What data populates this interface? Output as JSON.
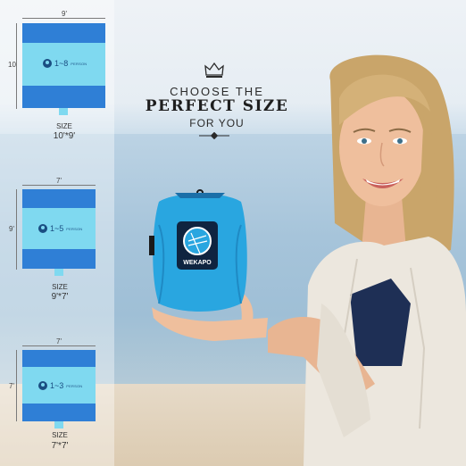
{
  "headline": {
    "line1": "CHOOSE THE",
    "line2": "PERFECT SIZE",
    "line3": "FOR YOU"
  },
  "sizes": [
    {
      "width_label": "9'",
      "height_label": "10'",
      "capacity": "1~8",
      "capacity_unit": "PERSON",
      "size_caption": "SIZE",
      "size_value": "10'*9'"
    },
    {
      "width_label": "7'",
      "height_label": "9'",
      "capacity": "1~5",
      "capacity_unit": "PERSON",
      "size_caption": "SIZE",
      "size_value": "9'*7'"
    },
    {
      "width_label": "7'",
      "height_label": "7'",
      "capacity": "1~3",
      "capacity_unit": "PERSON",
      "size_caption": "SIZE",
      "size_value": "7'*7'"
    }
  ],
  "product": {
    "brand": "WEKAPO"
  },
  "colors": {
    "mat_dark": "#2f7fd6",
    "mat_light": "#7fd9f0",
    "bag": "#29a6e0"
  },
  "icons": [
    "crown-icon",
    "person-icon",
    "ornament-divider"
  ]
}
